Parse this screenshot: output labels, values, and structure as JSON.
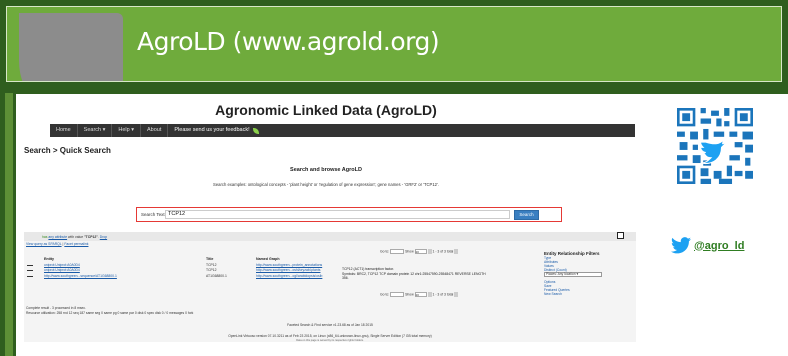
{
  "banner": {
    "title": "AgroLD (www.agrold.org)"
  },
  "page": {
    "title": "Agronomic Linked Data (AgroLD)",
    "nav": [
      "Home",
      "Search",
      "Help",
      "About",
      "Please send us your feedback!"
    ],
    "heading": "Search > Quick Search",
    "search_title": "Search and browse AgroLD",
    "search_examples": "Search examples: ontological concepts - 'plant height' or 'regulation of gene expression'; gene names - 'GRF2' or 'TCP12'.",
    "search_label": "Search Text",
    "search_value": "TCP12",
    "search_button": "Search"
  },
  "results": {
    "summary_prefix": "has",
    "summary_link1": "any attribute",
    "summary_mid": "with value",
    "summary_value": "\"TCP12\"",
    "summary_drop": "Drop",
    "view_query": "View query as SPARQL",
    "facet_permalink": "Facet permalink",
    "go_to": "Go to:",
    "show": "Show",
    "show_count": "20",
    "range_text": "1 - 3 of 3 total",
    "columns": [
      "Entity",
      "Title",
      "Named Graph"
    ],
    "rows": [
      {
        "entity": "uniprot:Uniprot:A0A0D4",
        "title": "TCP12",
        "graph": "http://www.southgreen...protein_annotations"
      },
      {
        "entity": "uniprot:Uniprot:A0A0D4",
        "title": "TCP12",
        "graph": "http://www.southgreen...oshl/oryzabl.plants"
      },
      {
        "entity": "http://www.southgreen...sequence/AT1G68800.1",
        "title": "AT1G68800.1",
        "graph": "http://www.southgreen...ogl/arabidopsis/oslb"
      }
    ],
    "description_line1": "TCP12 (ACT1) transcription factor.",
    "description_line2": "Symbols: BRC2, TCP12 TCP domain protein 12 chr1:25547590-25548471 REVERSE LENGTH 356.",
    "status_line1": "Complete result - 3 processed in 8 msec.",
    "status_line2": "Resource utilization: 258 rnd 12 seq 187 same seg 0 same pg 0 same par 0 disk 0 spec disk 0 / 0 messages 0 fork",
    "footer_line1": "Faceted Search & Find service v1.23.68 as of Jan 18 2015",
    "footer_line2": "OpenLink Virtuoso version 07.10.3211 as of Feb 23 2015, on Linux (x86_64-unknown-linux-gnu), Single Server Edition (7 GB total memory)",
    "footer_line3": "Data on this page is owned by its respective rights holders.",
    "footer_line4": "Virtuoso Faceted Browser Copyright © 2009-2015 OpenLink Software"
  },
  "sidepanel": {
    "title": "Entity Relationship Filters",
    "links": [
      "Type",
      "Attributes",
      "Values",
      "Distinct (Count)"
    ],
    "places_label": "Places",
    "places_value": "Any location",
    "options": [
      "Options",
      "Save",
      "Featured Queries",
      "New Search"
    ]
  },
  "right": {
    "twitter_handle": "@agro_ld"
  },
  "colors": {
    "banner_dark": "#2f5e1e",
    "banner_green": "#6fab3c",
    "search_border": "#e53935",
    "link_blue": "#1a5ba8",
    "twitter_blue": "#1da1f2",
    "qr_blue": "#1b75bb"
  },
  "icons": [
    "twitter-bird-icon",
    "qr-code-icon",
    "feedback-leaf-icon"
  ]
}
